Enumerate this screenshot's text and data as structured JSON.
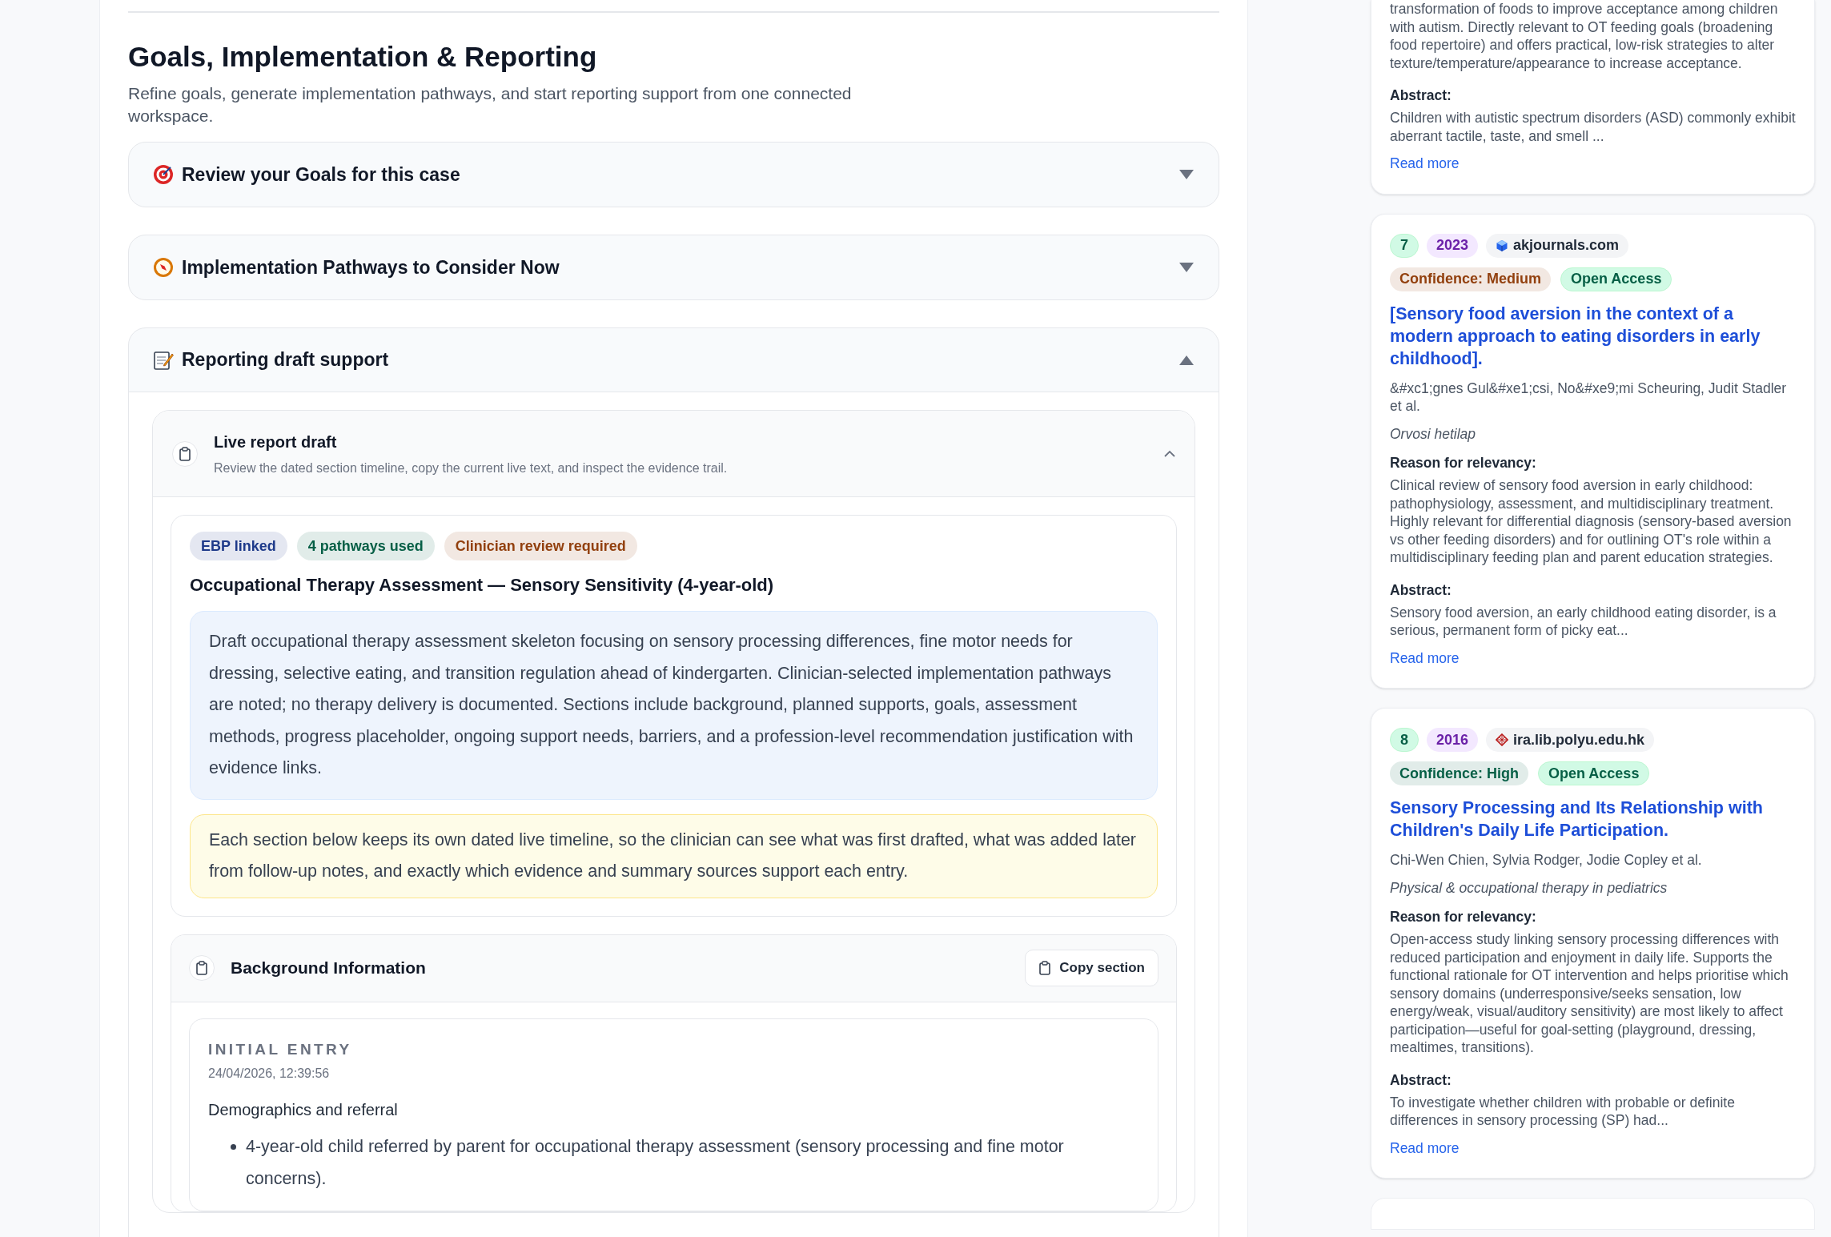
{
  "heading": "Goals, Implementation & Reporting",
  "subtitle": "Refine goals, generate implementation pathways, and start reporting support from one connected workspace.",
  "sections": [
    {
      "title": "Review your Goals for this case",
      "expanded": false
    },
    {
      "title": "Implementation Pathways to Consider Now",
      "expanded": false
    },
    {
      "title": "Reporting draft support",
      "expanded": true
    }
  ],
  "live_report": {
    "title": "Live report draft",
    "description": "Review the dated section timeline, copy the current live text, and inspect the evidence trail.",
    "expanded": true,
    "badges": [
      {
        "label": "EBP linked",
        "color": "#1e3a8a"
      },
      {
        "label": "4 pathways used",
        "color": "#065f46"
      },
      {
        "label": "Clinician review required",
        "color": "#92400e"
      }
    ],
    "report_title": "Occupational Therapy Assessment — Sensory Sensitivity (4-year-old)",
    "summary": "Draft occupational therapy assessment skeleton focusing on sensory processing differences, fine motor needs for dressing, selective eating, and transition regulation ahead of kindergarten. Clinician-selected implementation pathways are noted; no therapy delivery is documented. Sections include background, planned supports, goals, assessment methods, progress placeholder, ongoing support needs, barriers, and a profession-level recommendation justification with evidence links.",
    "note": "Each section below keeps its own dated live timeline, so the clinician can see what was first drafted, what was added later from follow-up notes, and exactly which evidence and summary sources support each entry.",
    "report_sections": [
      {
        "title": "Background Information",
        "copy_button": "Copy section",
        "entries": [
          {
            "label": "INITIAL ENTRY",
            "timestamp": "24/04/2026, 12:39:56",
            "heading": "Demographics and referral",
            "bullets": [
              "4-year-old child referred by parent for occupational therapy assessment (sensory processing and fine motor concerns)."
            ]
          }
        ]
      }
    ]
  },
  "references": [
    {
      "partial": true,
      "relevance": "transformation of foods to improve acceptance among children with autism. Directly relevant to OT feeding goals (broadening food repertoire) and offers practical, low-risk strategies to alter texture/temperature/appearance to increase acceptance.",
      "abstract_label": "Abstract:",
      "abstract": "Children with autistic spectrum disorders (ASD) commonly exhibit aberrant tactile, taste, and smell ...",
      "read_more": "Read more"
    },
    {
      "partial": false,
      "rank": "7",
      "year": "2023",
      "source": "akjournals.com",
      "confidence": {
        "label": "Confidence: Medium",
        "color": "#92400e"
      },
      "access": "Open Access",
      "title": "[Sensory food aversion in the context of a modern approach to eating disorders in early childhood].",
      "authors": "&#xc1;gnes Gul&#xe1;csi, No&#xe9;mi Scheuring, Judit Stadler et al.",
      "journal": "Orvosi hetilap",
      "relevance_label": "Reason for relevancy:",
      "relevance": "Clinical review of sensory food aversion in early childhood: pathophysiology, assessment, and multidisciplinary treatment. Highly relevant for differential diagnosis (sensory-based aversion vs other feeding disorders) and for outlining OT's role within a multidisciplinary feeding plan and parent education strategies.",
      "abstract_label": "Abstract:",
      "abstract": "Sensory food aversion, an early childhood eating disorder, is a serious, permanent form of picky eat...",
      "read_more": "Read more"
    },
    {
      "partial": false,
      "rank": "8",
      "year": "2016",
      "source": "ira.lib.polyu.edu.hk",
      "confidence": {
        "label": "Confidence: High",
        "color": "#065f46"
      },
      "access": "Open Access",
      "title": "Sensory Processing and Its Relationship with Children's Daily Life Participation.",
      "authors": "Chi-Wen Chien, Sylvia Rodger, Jodie Copley et al.",
      "journal": "Physical & occupational therapy in pediatrics",
      "relevance_label": "Reason for relevancy:",
      "relevance": "Open-access study linking sensory processing differences with reduced participation and enjoyment in daily life. Supports the functional rationale for OT intervention and helps prioritise which sensory domains (underresponsive/seeks sensation, low energy/weak, visual/auditory sensitivity) are most likely to affect participation—useful for goal-setting (playground, dressing, mealtimes, transitions).",
      "abstract_label": "Abstract:",
      "abstract": "To investigate whether children with probable or definite differences in sensory processing (SP) had...",
      "read_more": "Read more"
    }
  ]
}
